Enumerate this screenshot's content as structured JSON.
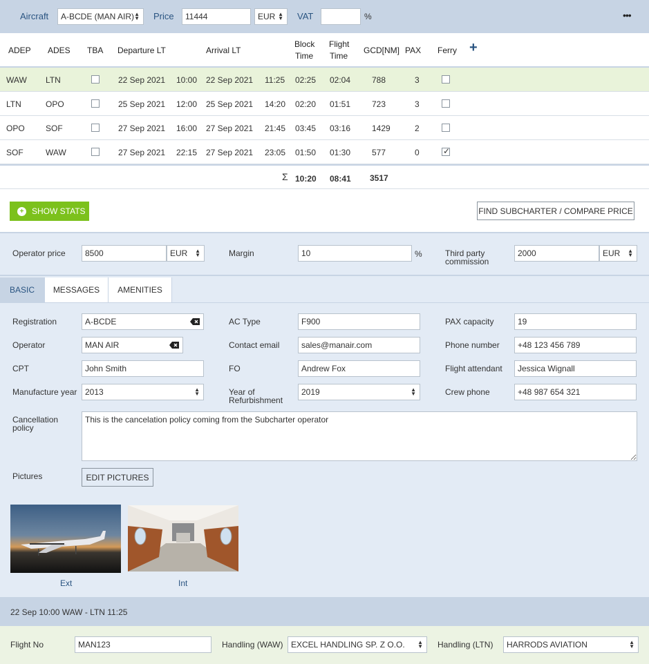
{
  "top": {
    "aircraft_label": "Aircraft",
    "aircraft_value": "A-BCDE (MAN AIR)",
    "price_label": "Price",
    "price_value": "11444",
    "currency": "EUR",
    "vat_label": "VAT",
    "vat_value": "",
    "vat_unit": "%",
    "more_label": "•••"
  },
  "table": {
    "headers": {
      "adep": "ADEP",
      "ades": "ADES",
      "tba": "TBA",
      "departure": "Departure LT",
      "arrival": "Arrival LT",
      "block1": "Block",
      "block2": "Time",
      "flight1": "Flight",
      "flight2": "Time",
      "gcd": "GCD[NM]",
      "pax": "PAX",
      "ferry": "Ferry",
      "add": "+"
    },
    "rows": [
      {
        "adep": "WAW",
        "ades": "LTN",
        "dep_date": "22 Sep 2021",
        "dep_time": "10:00",
        "arr_date": "22 Sep 2021",
        "arr_time": "11:25",
        "block": "02:25",
        "flight": "02:04",
        "gcd": "788",
        "pax": "3",
        "ferry": false
      },
      {
        "adep": "LTN",
        "ades": "OPO",
        "dep_date": "25 Sep 2021",
        "dep_time": "12:00",
        "arr_date": "25 Sep 2021",
        "arr_time": "14:20",
        "block": "02:20",
        "flight": "01:51",
        "gcd": "723",
        "pax": "3",
        "ferry": false
      },
      {
        "adep": "OPO",
        "ades": "SOF",
        "dep_date": "27 Sep 2021",
        "dep_time": "16:00",
        "arr_date": "27 Sep 2021",
        "arr_time": "21:45",
        "block": "03:45",
        "flight": "03:16",
        "gcd": "1429",
        "pax": "2",
        "ferry": false
      },
      {
        "adep": "SOF",
        "ades": "WAW",
        "dep_date": "27 Sep 2021",
        "dep_time": "22:15",
        "arr_date": "27 Sep 2021",
        "arr_time": "23:05",
        "block": "01:50",
        "flight": "01:30",
        "gcd": "577",
        "pax": "0",
        "ferry": true
      }
    ],
    "totals": {
      "sigma": "Σ",
      "block": "10:20",
      "flight": "08:41",
      "gcd": "3517"
    }
  },
  "stats": {
    "show_stats": "SHOW STATS",
    "find_subcharter": "FIND SUBCHARTER / COMPARE PRICE"
  },
  "pricing": {
    "operator_price_label": "Operator price",
    "operator_price": "8500",
    "operator_currency": "EUR",
    "margin_label": "Margin",
    "margin": "10",
    "margin_unit": "%",
    "third_party_label1": "Third party",
    "third_party_label2": "commission",
    "third_party": "2000",
    "third_party_currency": "EUR"
  },
  "tabs": {
    "basic": "BASIC",
    "messages": "MESSAGES",
    "amenities": "AMENITIES"
  },
  "basic": {
    "registration_label": "Registration",
    "registration": "A-BCDE",
    "ac_type_label": "AC Type",
    "ac_type": "F900",
    "pax_capacity_label": "PAX capacity",
    "pax_capacity": "19",
    "operator_label": "Operator",
    "operator": "MAN AIR",
    "contact_email_label": "Contact email",
    "contact_email": "sales@manair.com",
    "phone_label": "Phone number",
    "phone": "+48 123 456 789",
    "cpt_label": "CPT",
    "cpt": "John Smith",
    "fo_label": "FO",
    "fo": "Andrew Fox",
    "attendant_label": "Flight attendant",
    "attendant": "Jessica Wignall",
    "manufacture_label": "Manufacture year",
    "manufacture": "2013",
    "refurb_label1": "Year of",
    "refurb_label2": "Refurbishment",
    "refurb": "2019",
    "crew_phone_label": "Crew phone",
    "crew_phone": "+48 987 654 321",
    "cancel_label1": "Cancellation",
    "cancel_label2": "policy",
    "cancel_policy": "This is the cancelation policy coming from the Subcharter operator",
    "pictures_label": "Pictures",
    "edit_pictures": "EDIT PICTURES",
    "pic_ext": "Ext",
    "pic_int": "Int"
  },
  "leg": {
    "title": "22 Sep 10:00 WAW - LTN 11:25",
    "flight_no_label": "Flight No",
    "flight_no": "MAN123",
    "handling_waw_label": "Handling (WAW)",
    "handling_waw": "EXCEL HANDLING SP. Z O.O.",
    "handling_ltn_label": "Handling (LTN)",
    "handling_ltn": "HARRODS AVIATION"
  },
  "colors": {
    "accent": "#2a5481",
    "green": "#7cc11c",
    "header_bg": "#c7d4e4",
    "panel_bg": "#e3ebf5",
    "selected_row": "#e9f3da"
  }
}
